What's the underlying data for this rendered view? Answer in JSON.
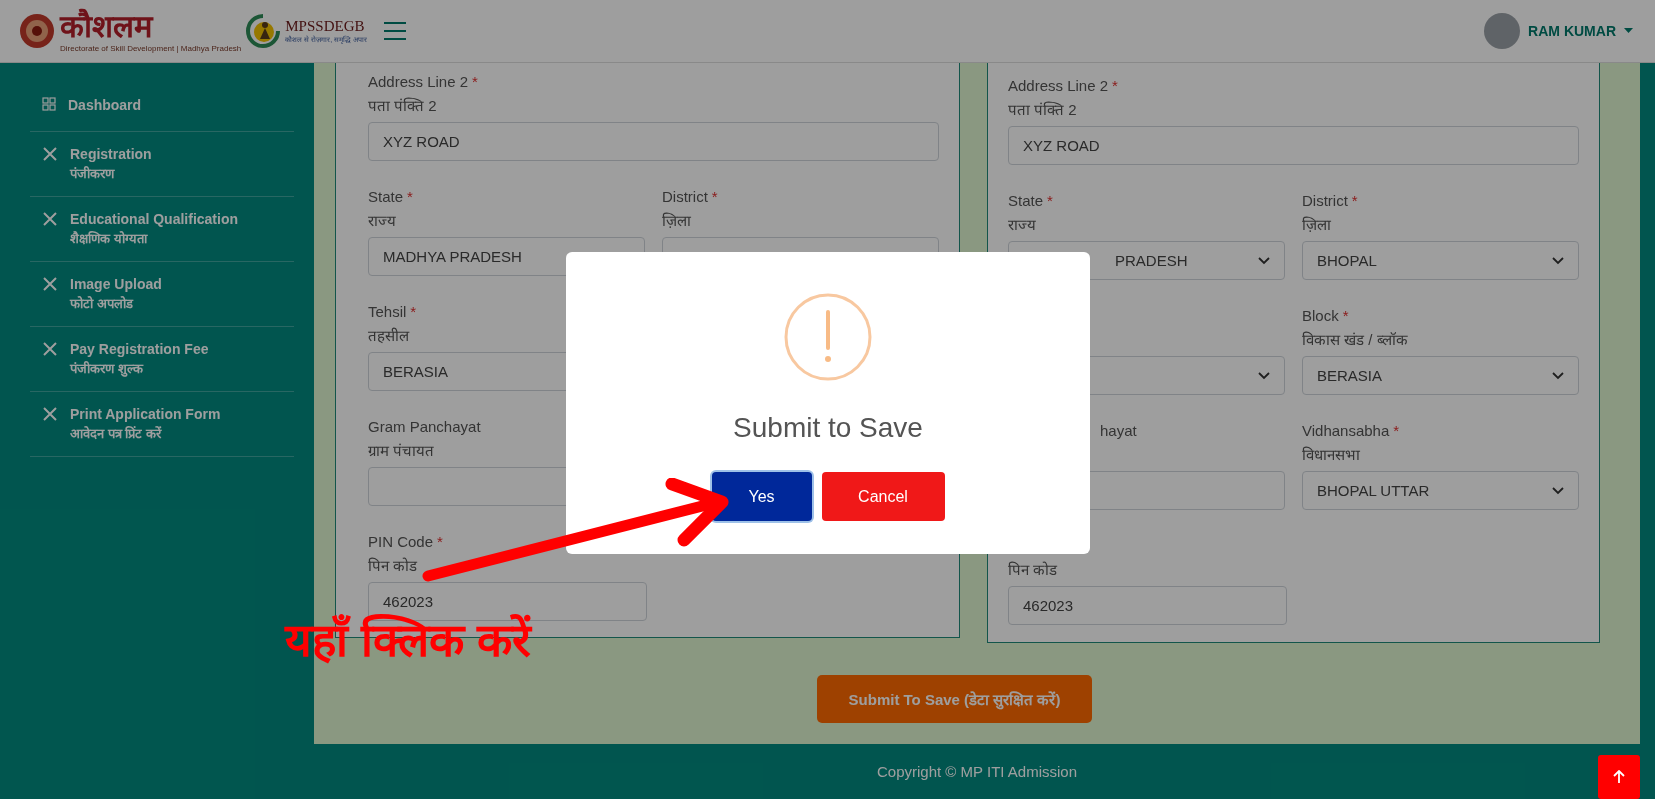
{
  "header": {
    "logo_title": "कौशलम",
    "logo_subtitle": "Directorate of Skill Development | Madhya Pradesh",
    "brand": "MPSSDEGB",
    "brand_tagline": "कौशल से रोज़गार, समृद्धि अपार",
    "user": {
      "name": "RAM KUMAR"
    }
  },
  "sidebar": {
    "items": [
      {
        "kind": "home",
        "label": "Dashboard"
      },
      {
        "kind": "step",
        "label": "Registration",
        "sublabel": "पंजीकरण"
      },
      {
        "kind": "step",
        "label": "Educational Qualification",
        "sublabel": "शैक्षणिक योग्यता"
      },
      {
        "kind": "step",
        "label": "Image Upload",
        "sublabel": "फोटो अपलोड"
      },
      {
        "kind": "step",
        "label": "Pay Registration Fee",
        "sublabel": "पंजीकरण शुल्क"
      },
      {
        "kind": "step",
        "label": "Print Application Form",
        "sublabel": "आवेदन पत्र प्रिंट करें"
      }
    ]
  },
  "cards": [
    {
      "rows": [
        [
          {
            "kind": "input",
            "label": "Address Line 2",
            "required": true,
            "hindi": "पता पंक्ति 2",
            "value": "XYZ ROAD"
          }
        ],
        [
          {
            "kind": "input",
            "label": "State",
            "required": true,
            "hindi": "राज्य",
            "value": "MADHYA PRADESH"
          },
          {
            "kind": "input",
            "label": "District",
            "required": true,
            "hindi": "ज़िला"
          }
        ],
        [
          {
            "kind": "input",
            "label": "Tehsil",
            "required": true,
            "hindi": "तहसील",
            "value": "BERASIA"
          }
        ],
        [
          {
            "kind": "input",
            "label": "Gram Panchayat",
            "required": false,
            "hindi": "ग्राम पंचायत"
          }
        ],
        [
          {
            "kind": "input",
            "label": "PIN Code",
            "required": true,
            "hindi": "पिन कोड",
            "value": "462023"
          }
        ]
      ]
    },
    {
      "rows": [
        [
          {
            "kind": "input",
            "label": "Address Line 2",
            "required": true,
            "hindi": "पता पंक्ति 2",
            "value": "XYZ ROAD"
          }
        ],
        [
          {
            "kind": "select",
            "label": "State",
            "required": true,
            "hindi": "राज्य",
            "value": "PRADESH",
            "covered": true
          },
          {
            "kind": "select",
            "label": "District",
            "required": true,
            "hindi": "ज़िला",
            "value": "BHOPAL"
          }
        ],
        [
          {
            "kind": "select",
            "covered": true
          },
          {
            "kind": "select",
            "label": "Block",
            "required": true,
            "hindi": "विकास खंड / ब्लॉक",
            "value": "BERASIA"
          }
        ],
        [
          {
            "kind": "input",
            "label": "hayat",
            "covered": true
          },
          {
            "kind": "select",
            "label": "Vidhansabha",
            "required": true,
            "hindi": "विधानसभा",
            "value": "BHOPAL UTTAR"
          }
        ],
        [
          {
            "kind": "input",
            "hindi": "पिन कोड",
            "value": "462023"
          }
        ]
      ]
    }
  ],
  "required_mark": "*",
  "submit_button": "Submit To Save (डेटा सुरक्षित करें)",
  "footer": "Copyright © MP ITI Admission",
  "dialog": {
    "title": "Submit to Save",
    "buttons": [
      {
        "label": "Yes",
        "kind": "confirm",
        "focused": true
      },
      {
        "label": "Cancel",
        "kind": "cancel",
        "focused": false
      }
    ]
  },
  "annotation": {
    "text": "यहाँ क्लिक करें"
  }
}
